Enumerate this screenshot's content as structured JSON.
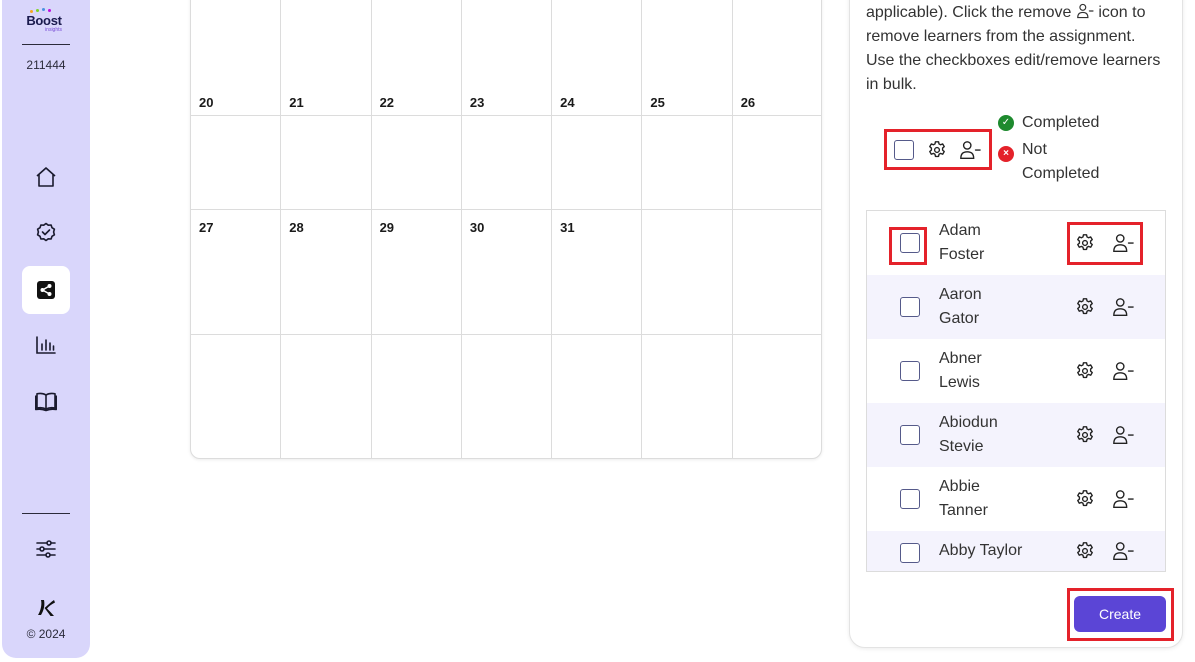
{
  "sidebar": {
    "logo_text": "Boost",
    "logo_sub": "insights",
    "user_id": "211444",
    "nav": [
      {
        "icon": "home-icon"
      },
      {
        "icon": "check-badge-icon"
      },
      {
        "icon": "share-icon",
        "active": true
      },
      {
        "icon": "bar-chart-icon"
      },
      {
        "icon": "book-icon"
      }
    ],
    "settings_icon": "sliders-icon",
    "brand_icon": "k-logo-icon",
    "copyright": "© 2024"
  },
  "calendar": {
    "rows": [
      [
        "",
        "",
        "",
        "",
        "",
        "",
        ""
      ],
      [
        "20",
        "21",
        "22",
        "23",
        "24",
        "25",
        "26"
      ],
      [
        "27",
        "28",
        "29",
        "30",
        "31",
        "",
        ""
      ],
      [
        "",
        "",
        "",
        "",
        "",
        "",
        ""
      ]
    ]
  },
  "panel": {
    "instructions_1": "applicable). Click the remove",
    "instructions_2": "icon to remove learners from the assignment. Use the checkboxes edit/remove learners in bulk.",
    "legend": {
      "completed": "Completed",
      "not_completed": "Not Completed"
    },
    "learners": [
      {
        "name": "Adam Foster"
      },
      {
        "name": "Aaron Gator"
      },
      {
        "name": "Abner Lewis"
      },
      {
        "name": "Abiodun Stevie"
      },
      {
        "name": "Abbie Tanner"
      },
      {
        "name": "Abby Taylor"
      }
    ],
    "create_label": "Create"
  },
  "colors": {
    "sidebar_bg": "#d9d6fb",
    "accent": "#5b45d6",
    "highlight": "#e4222a",
    "completed": "#1e8a2e",
    "not_completed": "#e4222a"
  }
}
